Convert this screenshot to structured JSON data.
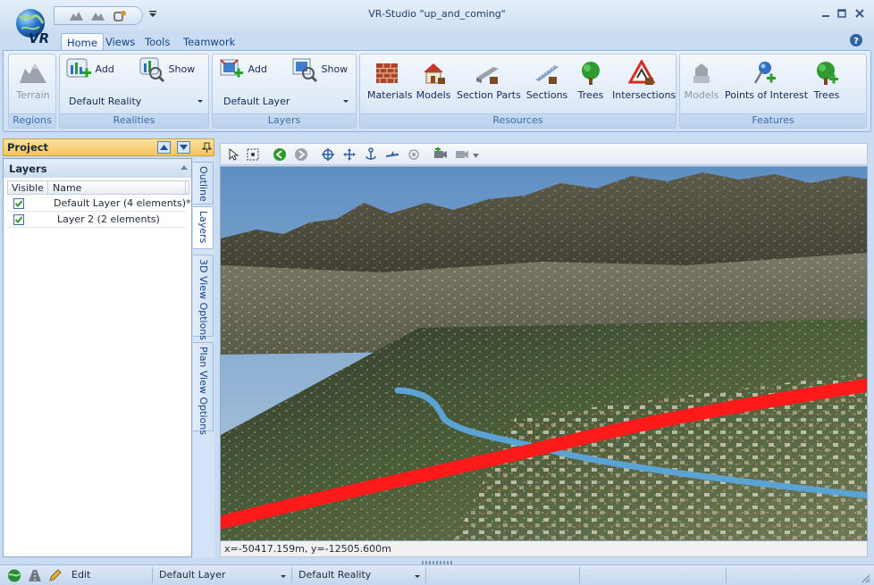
{
  "window": {
    "title": "VR-Studio \"up_and_coming\""
  },
  "tabs": [
    {
      "label": "Home",
      "active": true
    },
    {
      "label": "Views",
      "active": false
    },
    {
      "label": "Tools",
      "active": false
    },
    {
      "label": "Teamwork",
      "active": false
    }
  ],
  "ribbon": {
    "regions": {
      "group_label": "Regions",
      "terrain_label": "Terrain"
    },
    "realities": {
      "group_label": "Realities",
      "add_label": "Add",
      "show_label": "Show",
      "combo_value": "Default Reality"
    },
    "layers": {
      "group_label": "Layers",
      "add_label": "Add",
      "show_label": "Show",
      "combo_value": "Default Layer"
    },
    "resources": {
      "group_label": "Resources",
      "items": [
        "Materials",
        "Models",
        "Section Parts",
        "Sections",
        "Trees",
        "Intersections"
      ]
    },
    "features": {
      "group_label": "Features",
      "items": [
        "Models",
        "Points of Interest",
        "Trees"
      ]
    }
  },
  "project_panel": {
    "title": "Project",
    "layers_title": "Layers",
    "columns": [
      "Visible",
      "Name"
    ],
    "rows": [
      {
        "visible": true,
        "name": "Default Layer (4 elements)*"
      },
      {
        "visible": true,
        "name": "Layer 2 (2 elements)"
      }
    ],
    "side_tabs": [
      "Outline",
      "Layers",
      "3D View Options",
      "Plan View Options"
    ]
  },
  "viewport": {
    "coords": "x=-50417.159m, y=-12505.600m"
  },
  "statusbar": {
    "mode": "Edit",
    "layer": "Default Layer",
    "reality": "Default Reality"
  },
  "colors": {
    "accent": "#15428b",
    "road_red": "#ff1a1a",
    "river_blue": "#5aa3d2",
    "panel_header": "#f6c45b"
  }
}
